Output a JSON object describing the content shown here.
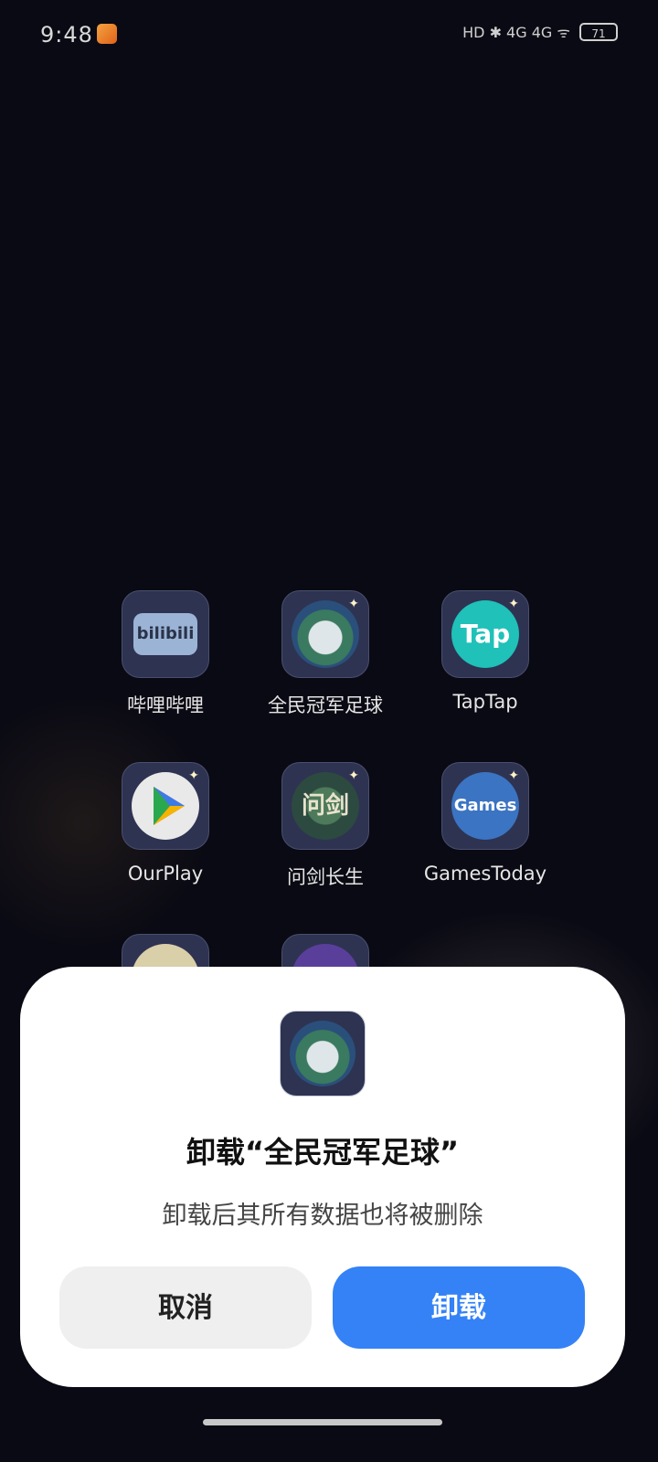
{
  "status_bar": {
    "time": "9:48",
    "indicators": "HD ✱ 4G 4G ᯤ",
    "battery": "71"
  },
  "folder": {
    "apps": [
      {
        "label": "哔哩哔哩",
        "icon": "bilibili-icon",
        "icon_text": "bilibili"
      },
      {
        "label": "全民冠军足球",
        "icon": "soccer-game-icon"
      },
      {
        "label": "TapTap",
        "icon": "taptap-icon",
        "icon_text": "Tap"
      },
      {
        "label": "OurPlay",
        "icon": "ourplay-icon"
      },
      {
        "label": "问剑长生",
        "icon": "wenjian-icon",
        "icon_text": "问剑"
      },
      {
        "label": "GamesToday",
        "icon": "gamestoday-icon",
        "icon_text": "Games"
      }
    ]
  },
  "dialog": {
    "title": "卸载“全民冠军足球”",
    "message": "卸载后其所有数据也将被删除",
    "cancel_label": "取消",
    "confirm_label": "卸载",
    "confirm_color": "#3482f6"
  }
}
